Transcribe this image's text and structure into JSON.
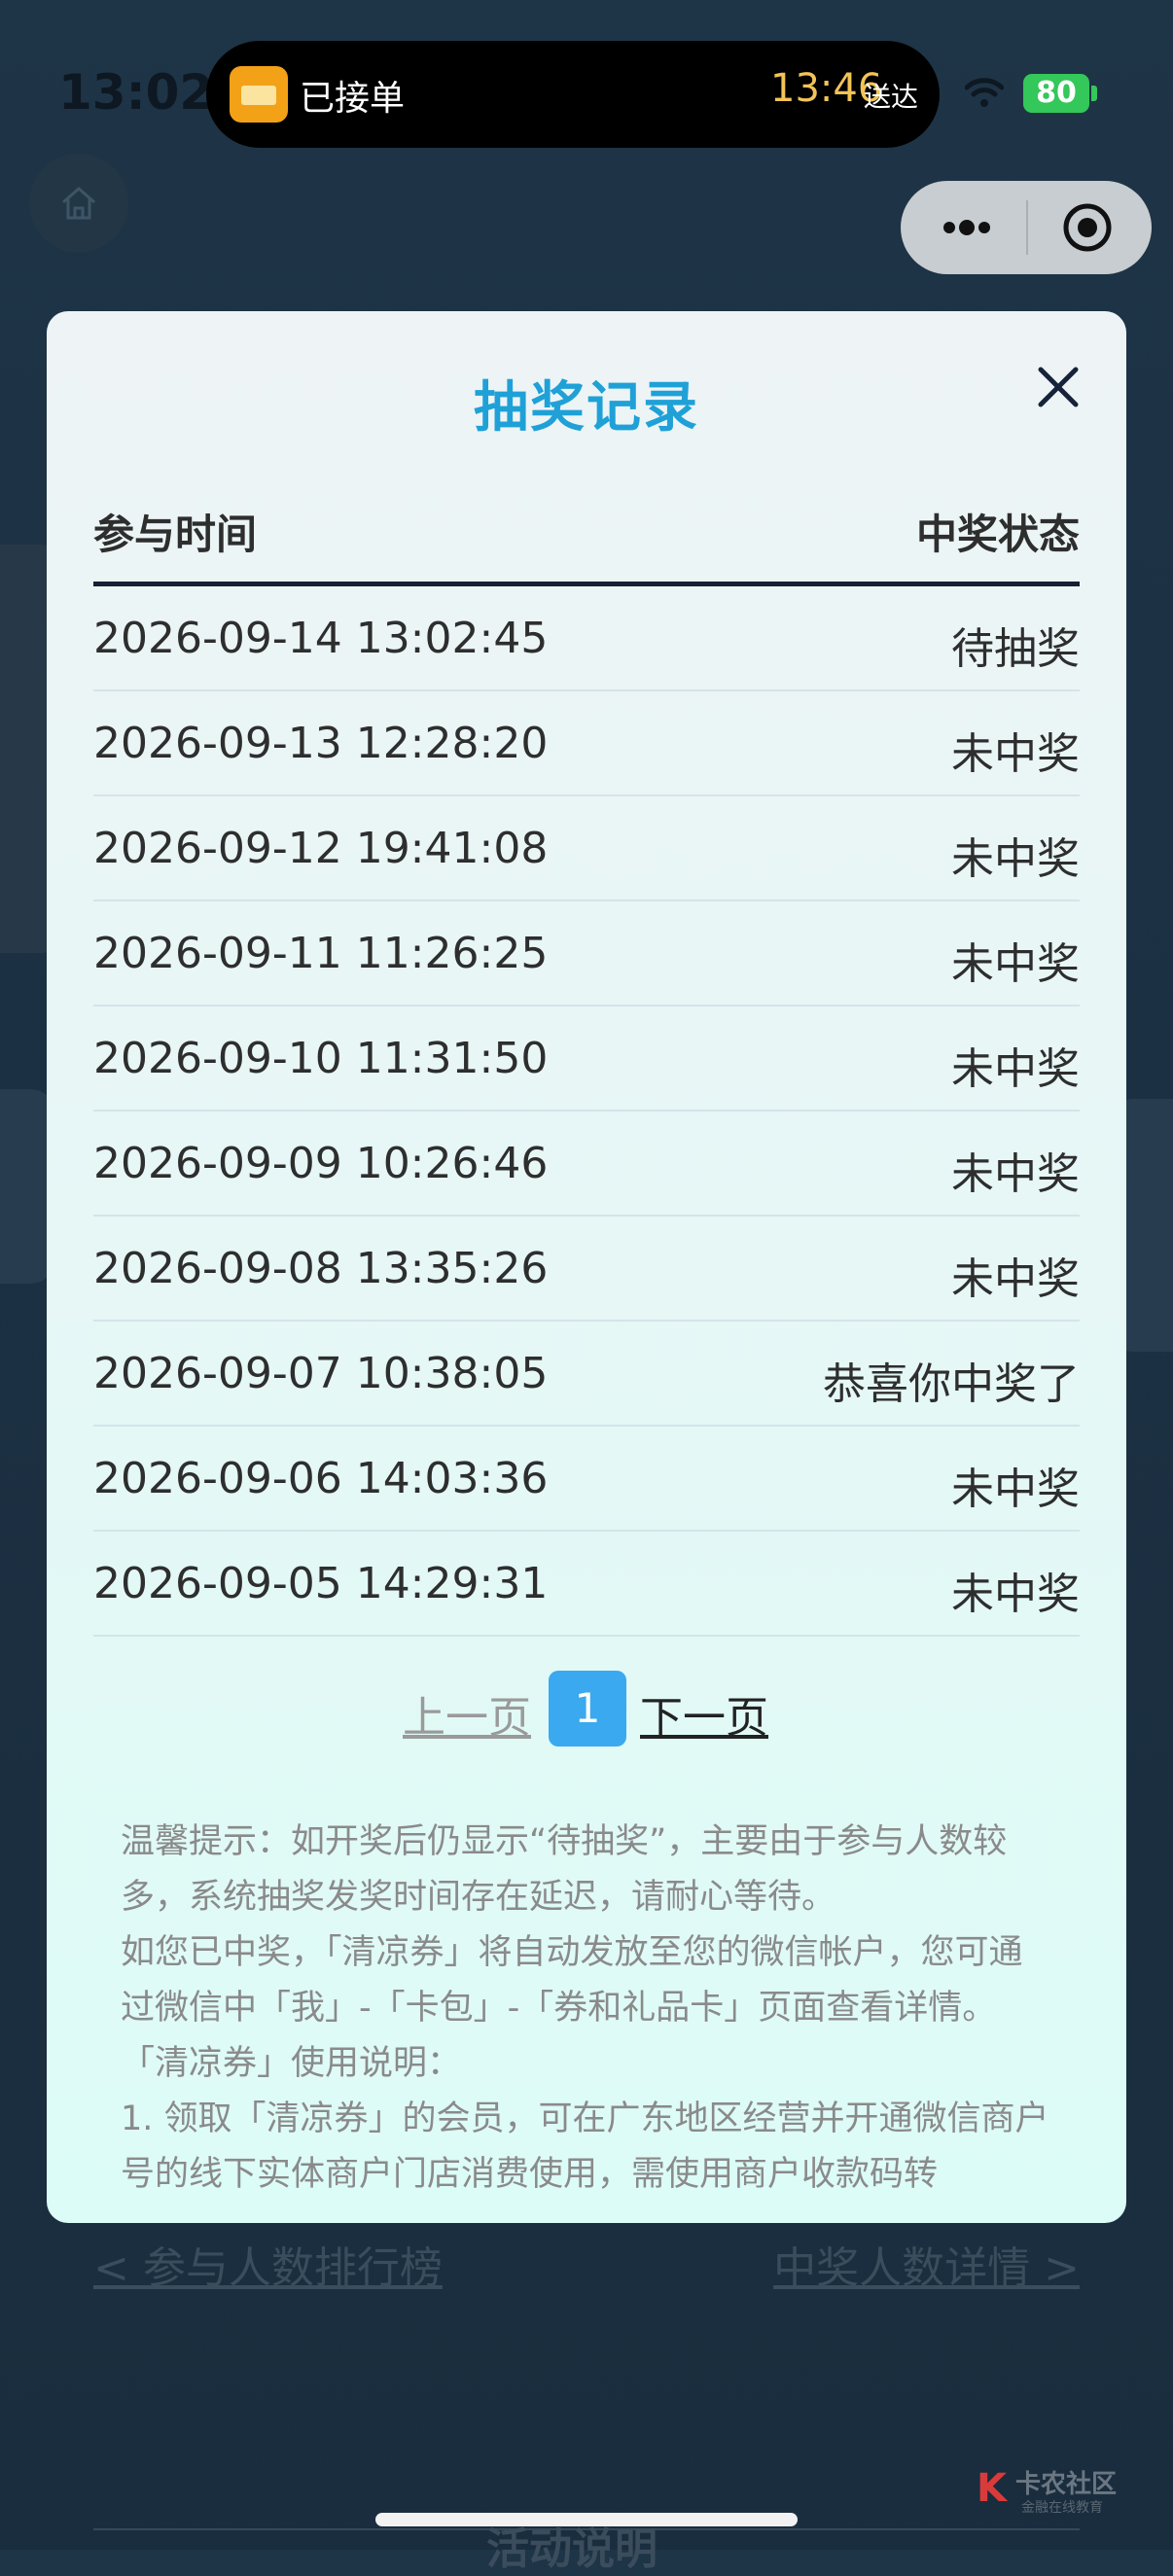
{
  "status_bar": {
    "time": "13:02",
    "island_label": "已接单",
    "island_eta": "13:46",
    "island_eta_suffix": "送达",
    "battery": "80"
  },
  "background": {
    "link_left": "< 参与人数排行榜",
    "link_right": "中奖人数详情 >",
    "section_title": "活动说明"
  },
  "modal": {
    "title": "抽奖记录",
    "col_time": "参与时间",
    "col_status": "中奖状态",
    "rows": [
      {
        "time": "2026-09-14 13:02:45",
        "status": "待抽奖"
      },
      {
        "time": "2026-09-13 12:28:20",
        "status": "未中奖"
      },
      {
        "time": "2026-09-12 19:41:08",
        "status": "未中奖"
      },
      {
        "time": "2026-09-11 11:26:25",
        "status": "未中奖"
      },
      {
        "time": "2026-09-10 11:31:50",
        "status": "未中奖"
      },
      {
        "time": "2026-09-09 10:26:46",
        "status": "未中奖"
      },
      {
        "time": "2026-09-08 13:35:26",
        "status": "未中奖"
      },
      {
        "time": "2026-09-07 10:38:05",
        "status": "恭喜你中奖了"
      },
      {
        "time": "2026-09-06 14:03:36",
        "status": "未中奖"
      },
      {
        "time": "2026-09-05 14:29:31",
        "status": "未中奖"
      }
    ],
    "pager": {
      "prev": "上一页",
      "current": "1",
      "next": "下一页"
    },
    "notes": [
      "温馨提示：如开奖后仍显示“待抽奖”，主要由于参与人数较多，系统抽奖发奖时间存在延迟，请耐心等待。",
      "如您已中奖，「清凉券」将自动发放至您的微信帐户，您可通过微信中「我」-「卡包」-「券和礼品卡」页面查看详情。",
      "「清凉券」使用说明：",
      "1. 领取「清凉券」的会员，可在广东地区经营并开通微信商户号的线下实体商户门店消费使用，需使用商户收款码转"
    ]
  },
  "watermark": {
    "mark": "K",
    "title": "卡农社区",
    "subtitle": "金融在线教育"
  },
  "icons": [
    "home-icon",
    "more-icon",
    "target-icon",
    "close-icon",
    "wifi-icon"
  ]
}
